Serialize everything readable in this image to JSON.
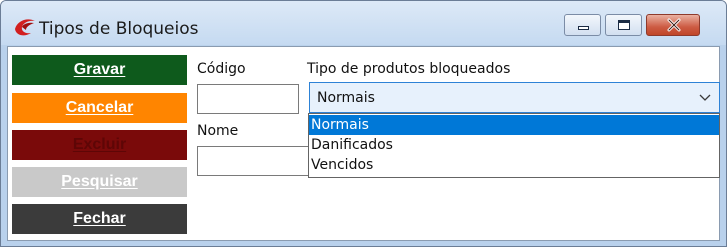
{
  "window": {
    "title": "Tipos de Bloqueios"
  },
  "toolbar": {
    "gravar": "Gravar",
    "cancelar": "Cancelar",
    "excluir": "Excluir",
    "pesquisar": "Pesquisar",
    "fechar": "Fechar"
  },
  "form": {
    "codigo_label": "Código",
    "codigo_value": "",
    "nome_label": "Nome",
    "nome_value": "",
    "tipo_label": "Tipo de produtos bloqueados",
    "tipo_selected": "Normais",
    "tipo_options": [
      "Normais",
      "Danificados",
      "Vencidos"
    ]
  },
  "colors": {
    "gravar": "#0e5a1c",
    "cancelar": "#ff8500",
    "excluir": "#7a0a0a",
    "pesquisar": "#c9c9c9",
    "fechar": "#3b3b3b",
    "selection": "#0078d7"
  },
  "icons": {
    "app": "red-swirl-app-icon",
    "minimize": "minimize-icon",
    "maximize": "maximize-icon",
    "close": "close-icon",
    "combo_arrow": "chevron-down-icon"
  }
}
